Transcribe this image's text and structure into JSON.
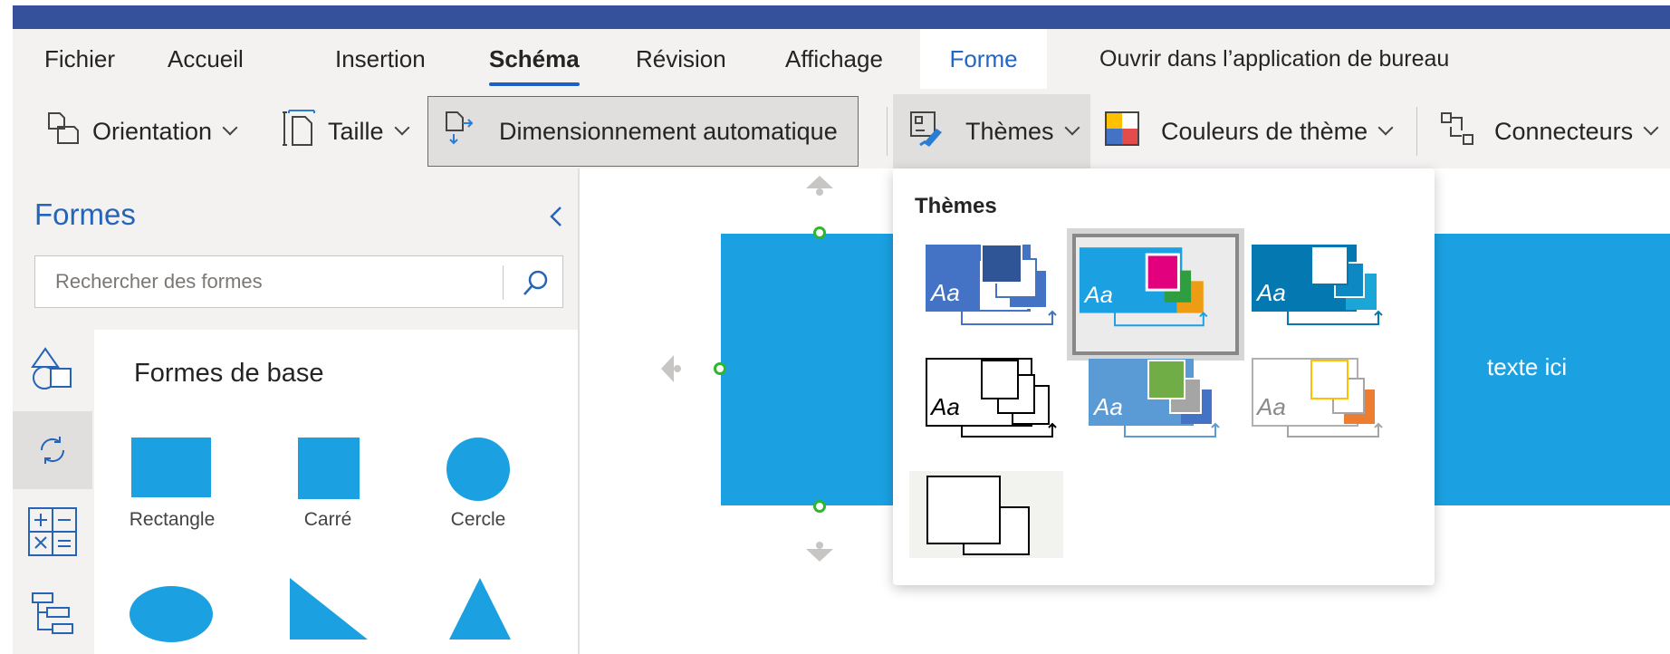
{
  "tabs": [
    {
      "label": "Fichier"
    },
    {
      "label": "Accueil"
    },
    {
      "label": "Insertion"
    },
    {
      "label": "Schéma"
    },
    {
      "label": "Révision"
    },
    {
      "label": "Affichage"
    },
    {
      "label": "Forme"
    },
    {
      "label": "Ouvrir dans l’application de bureau"
    }
  ],
  "active_tab": "Schéma",
  "toolbar": {
    "orientation_label": "Orientation",
    "taille_label": "Taille",
    "auto_size_label": "Dimensionnement automatique",
    "themes_label": "Thèmes",
    "theme_colors_label": "Couleurs de thème",
    "connectors_label": "Connecteurs"
  },
  "shapes_panel": {
    "title": "Formes",
    "search_placeholder": "Rechercher des formes",
    "category_title": "Formes de base",
    "shapes": [
      {
        "label": "Rectangle"
      },
      {
        "label": "Carré"
      },
      {
        "label": "Cercle"
      }
    ]
  },
  "canvas": {
    "shape_text": "texte ici"
  },
  "themes_dropdown": {
    "title": "Thèmes",
    "sample_text": "Aa",
    "selected_index": 1,
    "themes": [
      {
        "name": "theme-1",
        "colors": [
          "#4472c4",
          "#2f5597",
          "#4472c4"
        ]
      },
      {
        "name": "theme-2",
        "colors": [
          "#1ba1e2",
          "#e3007e",
          "#2e9e40",
          "#ed9c14"
        ]
      },
      {
        "name": "theme-3",
        "colors": [
          "#0478b0",
          "#0e88c2",
          "#1aa7d8"
        ]
      },
      {
        "name": "theme-4",
        "colors": [
          "#ffffff",
          "#000000"
        ]
      },
      {
        "name": "theme-5",
        "colors": [
          "#5b9bd5",
          "#70ad47",
          "#a5a5a5",
          "#4472c4"
        ]
      },
      {
        "name": "theme-6",
        "colors": [
          "#ffffff",
          "#ffc000",
          "#ed7d31",
          "#a5a5a5"
        ]
      },
      {
        "name": "theme-7",
        "colors": [
          "#f2f2ee",
          "#000000"
        ]
      }
    ]
  },
  "colors": {
    "title_bar": "#35519b",
    "accent": "#1f5ec5",
    "shape_fill": "#1ba1e2"
  }
}
